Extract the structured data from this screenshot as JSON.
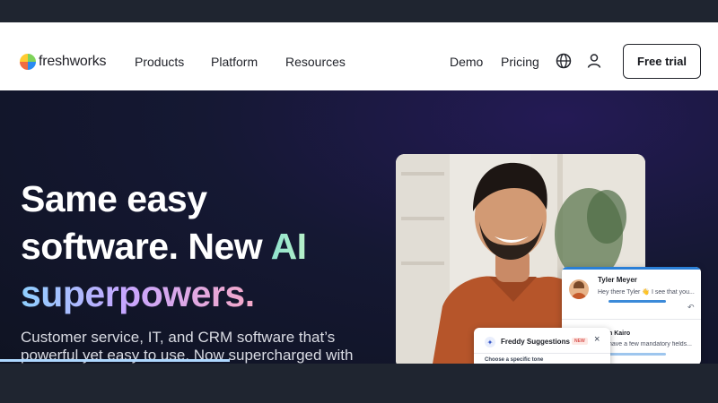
{
  "brand": {
    "name": "freshworks",
    "logo_colors": [
      "#7fd35a",
      "#2a8bf2",
      "#f06c43",
      "#ffcb2f"
    ]
  },
  "nav": {
    "left": [
      "Products",
      "Platform",
      "Resources"
    ],
    "right": [
      "Demo",
      "Pricing"
    ],
    "icons": [
      "globe-icon",
      "user-icon"
    ],
    "cta": "Free trial"
  },
  "hero": {
    "line1": "Same easy",
    "line2_prefix": "software. New ",
    "line2_highlight": "AI",
    "line3": "superpowers.",
    "sub_line1": "Customer service, IT, and CRM software that’s",
    "sub_line2": "powerful yet easy to use. Now supercharged with",
    "progress": 0.32,
    "accent_colors": [
      "#8fe3cf",
      "#8fd0ff",
      "#c7a6ff",
      "#f5a9c8"
    ]
  },
  "chat_card": {
    "name": "Tyler Meyer",
    "message": "Hey there Tyler 👋 I see that you...",
    "second_name": "n Kairo",
    "second_message": "have a few mandatory fields..."
  },
  "freddy_card": {
    "title": "Freddy Suggestions",
    "badge": "NEW",
    "option": "Choose a specific tone"
  }
}
